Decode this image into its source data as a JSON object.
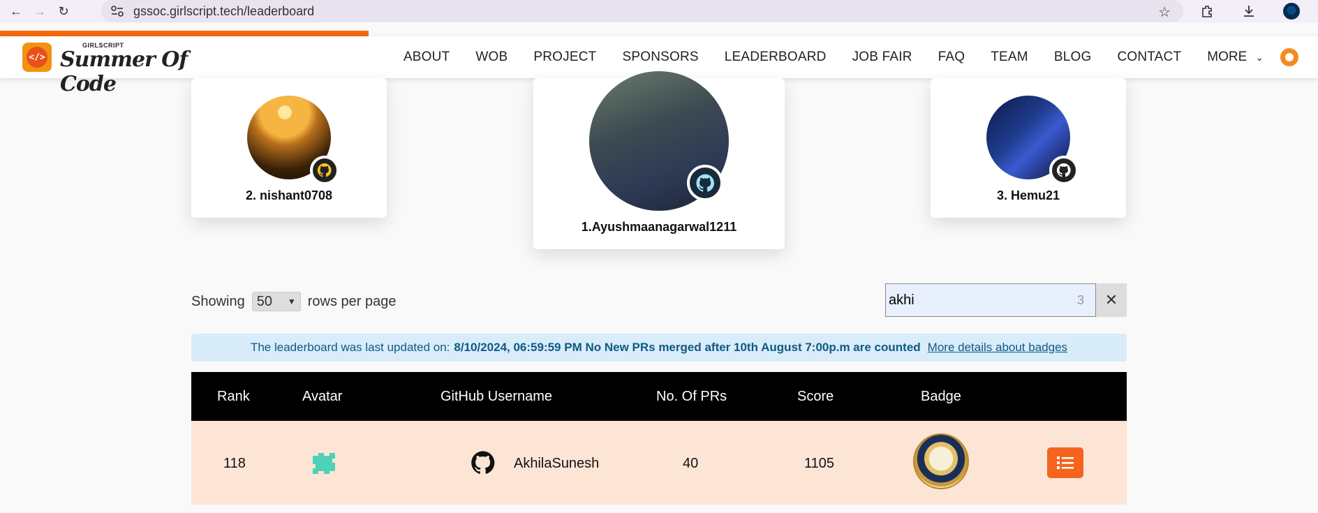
{
  "browser": {
    "url": "gssoc.girlscript.tech/leaderboard",
    "icons": [
      "back-icon",
      "forward-icon",
      "reload-icon",
      "site-info-icon",
      "bookmark-star-icon",
      "extensions-icon",
      "download-icon",
      "profile-icon"
    ]
  },
  "header": {
    "logo_small": "GIRLSCRIPT",
    "logo_main": "Summer Of Code",
    "logo_badge": "</>",
    "nav": {
      "about": "ABOUT",
      "wob": "WOB",
      "project": "PROJECT",
      "sponsors": "SPONSORS",
      "leaderboard": "LEADERBOARD",
      "job_fair": "JOB FAIR",
      "faq": "FAQ",
      "team": "TEAM",
      "blog": "BLOG",
      "contact": "CONTACT",
      "more": "MORE"
    },
    "accent": "#f6680a"
  },
  "podium": {
    "first": {
      "label": "1.Ayushmaanagarwal1211"
    },
    "second": {
      "label": "2. nishant0708"
    },
    "third": {
      "label": "3. Hemu21"
    }
  },
  "controls": {
    "showing": "Showing",
    "rows_value": "50",
    "rows_suffix": "rows per page",
    "search_value": "akhi",
    "search_count": "3",
    "clear": "✕"
  },
  "banner": {
    "prefix": "The leaderboard was last updated on:",
    "strong": "8/10/2024, 06:59:59 PM No New PRs merged after 10th August 7:00p.m are counted",
    "link": "More details about badges"
  },
  "table": {
    "headers": {
      "rank": "Rank",
      "avatar": "Avatar",
      "username": "GitHub Username",
      "prs": "No. Of PRs",
      "score": "Score",
      "badge": "Badge"
    },
    "rows": [
      {
        "rank": "118",
        "username": "AkhilaSunesh",
        "prs": "40",
        "score": "1105"
      }
    ]
  }
}
